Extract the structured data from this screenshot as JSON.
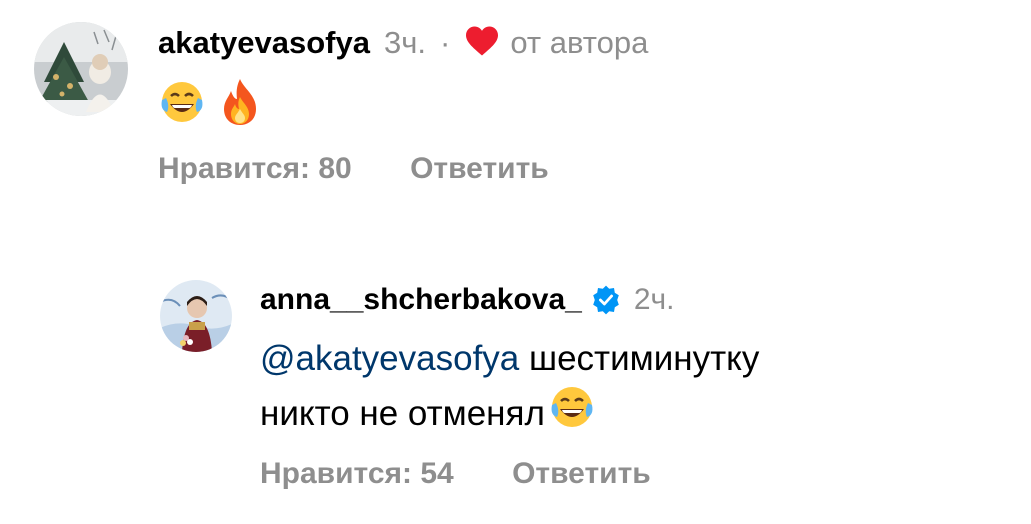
{
  "comments": [
    {
      "username": "akatyevasofya",
      "time": "3ч.",
      "separator": "·",
      "liked_by_author_label": "от автора",
      "emojis": [
        "tears-of-joy-emoji",
        "fire-emoji"
      ],
      "likes_label": "Нравится: 80",
      "reply_label": "Ответить"
    },
    {
      "username": "anna__shcherbakova_",
      "verified": true,
      "time": "2ч.",
      "mention": "@akatyevasofya",
      "text_line1": "шестиминутку",
      "text_line2": "никто не отменял",
      "emojis": [
        "tears-of-joy-emoji"
      ],
      "likes_label": "Нравится: 54",
      "reply_label": "Ответить"
    }
  ],
  "colors": {
    "meta_gray": "#8e8e8e",
    "mention_blue": "#00376b",
    "heart_red": "#ed1d2f",
    "verified_blue": "#0095f6"
  }
}
